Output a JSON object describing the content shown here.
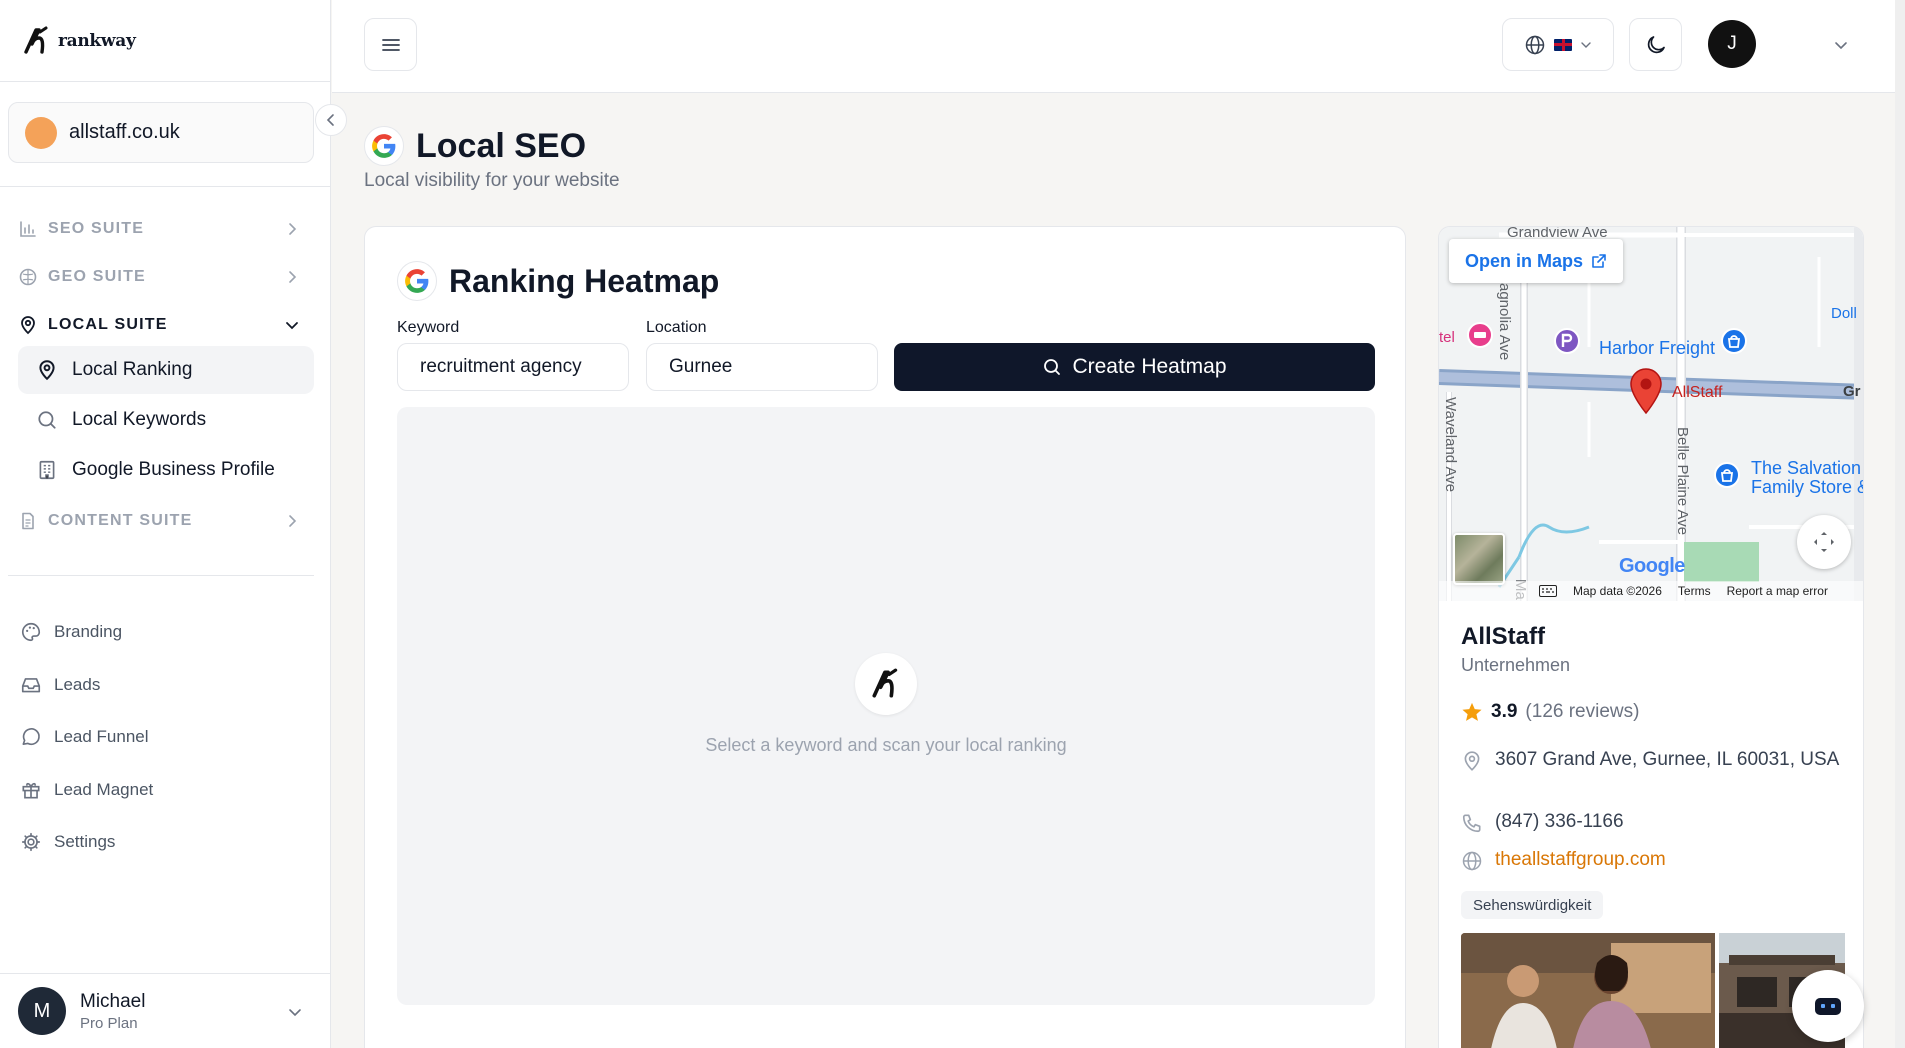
{
  "brand": {
    "name": "rankway"
  },
  "site": {
    "name": "allstaff.co.uk"
  },
  "sidebar": {
    "groups": [
      {
        "label": "SEO SUITE",
        "icon": "bar-chart-icon"
      },
      {
        "label": "GEO SUITE",
        "icon": "brain-icon"
      },
      {
        "label": "LOCAL SUITE",
        "icon": "map-pin-icon"
      },
      {
        "label": "CONTENT SUITE",
        "icon": "document-icon"
      }
    ],
    "local_items": [
      {
        "label": "Local Ranking",
        "icon": "map-pin-icon"
      },
      {
        "label": "Local Keywords",
        "icon": "search-icon"
      },
      {
        "label": "Google Business Profile",
        "icon": "building-icon"
      }
    ],
    "items": [
      {
        "label": "Branding",
        "icon": "palette-icon"
      },
      {
        "label": "Leads",
        "icon": "inbox-icon"
      },
      {
        "label": "Lead Funnel",
        "icon": "chat-icon"
      },
      {
        "label": "Lead Magnet",
        "icon": "gift-icon"
      },
      {
        "label": "Settings",
        "icon": "gear-icon"
      }
    ]
  },
  "user": {
    "initial": "M",
    "name": "Michael",
    "plan": "Pro Plan"
  },
  "header": {
    "avatar_initial": "J"
  },
  "page": {
    "title": "Local SEO",
    "subtitle": "Local visibility for your website"
  },
  "heatmap": {
    "title": "Ranking Heatmap",
    "keyword_label": "Keyword",
    "keyword_value": "recruitment agency",
    "location_label": "Location",
    "location_value": "Gurnee",
    "create_label": "Create Heatmap",
    "empty_text": "Select a keyword and scan your local ranking"
  },
  "map": {
    "open_label": "Open in Maps",
    "streets": [
      "Grandview Ave",
      "agnolia Ave",
      "Waveland Ave",
      "Belle Plaine Ave",
      "Ma",
      "Doll",
      "Gr",
      "tel"
    ],
    "pois": [
      "Harbor Freight",
      "AllStaff",
      "The Salvation",
      "Family Store &"
    ],
    "footer": [
      "Map data ©2026",
      "Terms",
      "Report a map error"
    ],
    "watermark": "Google"
  },
  "business": {
    "name": "AllStaff",
    "category": "Unternehmen",
    "rating": "3.9",
    "reviews": "(126 reviews)",
    "address": "3607 Grand Ave, Gurnee, IL 60031, USA",
    "phone": "(847) 336-1166",
    "website": "theallstaffgroup.com",
    "tag": "Sehenswürdigkeit"
  },
  "colors": {
    "accent": "#0f172a",
    "link": "#d97706",
    "map_link": "#1a73e8",
    "star": "#f59e0b",
    "pin": "#ea4335"
  }
}
